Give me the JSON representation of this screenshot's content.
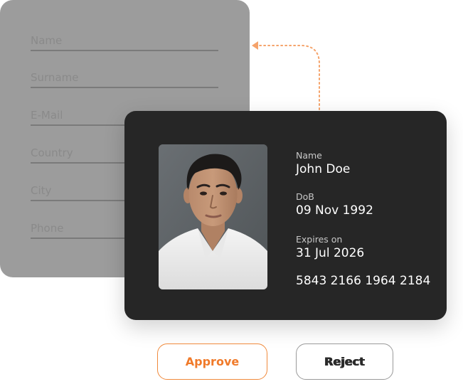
{
  "form": {
    "fields": [
      {
        "placeholder": "Name"
      },
      {
        "placeholder": "Surname"
      },
      {
        "placeholder": "E-Mail"
      },
      {
        "placeholder": "Country"
      },
      {
        "placeholder": "City"
      },
      {
        "placeholder": "Phone"
      }
    ]
  },
  "id_card": {
    "name_label": "Name",
    "name_value": "John Doe",
    "dob_label": "DoB",
    "dob_value": "09 Nov 1992",
    "expires_label": "Expires on",
    "expires_value": "31 Jul 2026",
    "card_number": "5843 2166 1964 2184"
  },
  "actions": {
    "approve_label": "Approve",
    "reject_label": "Reject"
  },
  "colors": {
    "accent": "#f07a2a",
    "card_bg": "#262626",
    "form_bg": "#9c9c9c"
  },
  "icons": {
    "connector": "dotted-arrow-icon"
  }
}
